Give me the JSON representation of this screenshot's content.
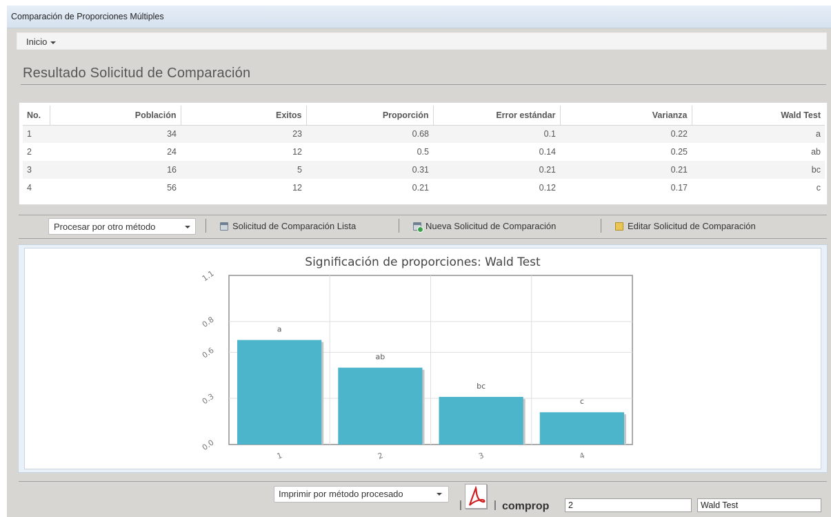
{
  "window": {
    "title": "Comparación de Proporciones Múltiples"
  },
  "menu": {
    "inicio_label": "Inicio"
  },
  "page": {
    "title": "Resultado Solicitud de Comparación"
  },
  "table": {
    "headers": [
      "No.",
      "Población",
      "Exitos",
      "Proporción",
      "Error estándar",
      "Varianza",
      "Wald Test"
    ],
    "rows": [
      [
        "1",
        "34",
        "23",
        "0.68",
        "0.1",
        "0.22",
        "a"
      ],
      [
        "2",
        "24",
        "12",
        "0.5",
        "0.14",
        "0.25",
        "ab"
      ],
      [
        "3",
        "16",
        "5",
        "0.31",
        "0.21",
        "0.21",
        "bc"
      ],
      [
        "4",
        "56",
        "12",
        "0.21",
        "0.12",
        "0.17",
        "c"
      ]
    ]
  },
  "toolbar": {
    "method_select": "Procesar por otro método",
    "list_label": "Solicitud de Comparación Lista",
    "new_label": "Nueva Solicitud de Comparación",
    "edit_label": "Editar Solicitud de Comparación"
  },
  "chart_data": {
    "type": "bar",
    "title": "Significación de proporciones: Wald Test",
    "categories": [
      "1",
      "2",
      "3",
      "4"
    ],
    "values": [
      0.68,
      0.5,
      0.31,
      0.21
    ],
    "bar_labels": [
      "a",
      "ab",
      "bc",
      "c"
    ],
    "y_ticks": [
      "0.0",
      "0.3",
      "0.6",
      "0.8",
      "1.1"
    ],
    "ylim": [
      0,
      1.1
    ],
    "grid": true,
    "bar_color": "#4db5cb"
  },
  "footer": {
    "print_select": "Imprimir por método procesado",
    "comprop_label": "comprop",
    "comprop_value": "2",
    "method_value": "Wald Test"
  }
}
